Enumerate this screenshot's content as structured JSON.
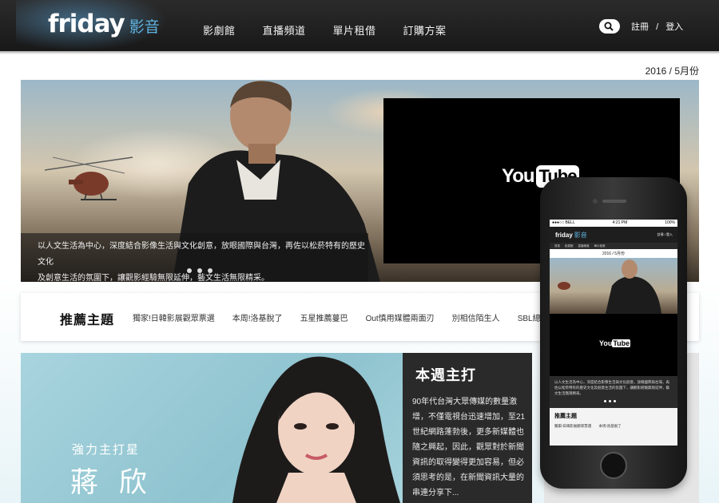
{
  "header": {
    "logo_text": "friday",
    "logo_sub": "影音",
    "nav": [
      "影劇館",
      "直播頻道",
      "單片租借",
      "訂購方案"
    ],
    "register": "註冊",
    "separator": "/",
    "login": "登入"
  },
  "date_label": "2016 / 5月份",
  "hero": {
    "caption_line1": "以人文生活為中心，深度結合影像生活與文化創意，放眼國際與台灣，再佐以松菸特有的歷史文化",
    "caption_line2": "及創意生活的氛圍下，讓觀影經驗無限延伸，藝文生活無限精采。",
    "video_logo_you": "You",
    "video_logo_tube": "Tube",
    "slides": 3,
    "active_slide": 1
  },
  "topics": {
    "title": "推薦主題",
    "items": [
      "獨家!日韓影展觀眾票選",
      "本周!洛基脫了",
      "五星推薦蔓巴",
      "Out慎用媒體兩面刃",
      "別相信陌生人",
      "SBL總冠軍賽"
    ]
  },
  "feature": {
    "tag": "強力主打星",
    "name": "蔣 欣",
    "panel_title": "本週主打",
    "panel_text": "90年代台灣大眾傳媒的數量激增，不僅電視台迅速增加，至21世紀網路蓬勃後，更多新媒體也隨之興起，因此，觀眾對於新聞資訊的取得變得更加容易，但必須思考的是，在新聞資訊大量的串連分享下..."
  },
  "phone": {
    "carrier": "●●●○○ BELL",
    "time": "4:21 PM",
    "battery": "100%",
    "logo_text": "friday",
    "logo_sub": "影音",
    "auth": "註冊 / 登入",
    "nav": [
      "首頁",
      "影劇館",
      "直播頻道",
      "單片租借"
    ],
    "date": "2016 / 5月份",
    "yt_you": "You",
    "yt_tube": "Tube",
    "caption": "以人文生活為中心，深度結合影像生活與文化創意，放眼國際與台灣，再佐以松菸特有的歷史文化及創意生活的氛圍下，讓觀影經驗無限延伸，藝文生活無限精采。",
    "topics_title": "推薦主題",
    "topics": [
      "獨家!日韓影展觀眾票選",
      "本周!洛基脫了"
    ]
  },
  "colors": {
    "header_bg": "#1e1e1e",
    "accent_blue": "#5fb3e0",
    "panel_bg": "#2a2a2a"
  }
}
